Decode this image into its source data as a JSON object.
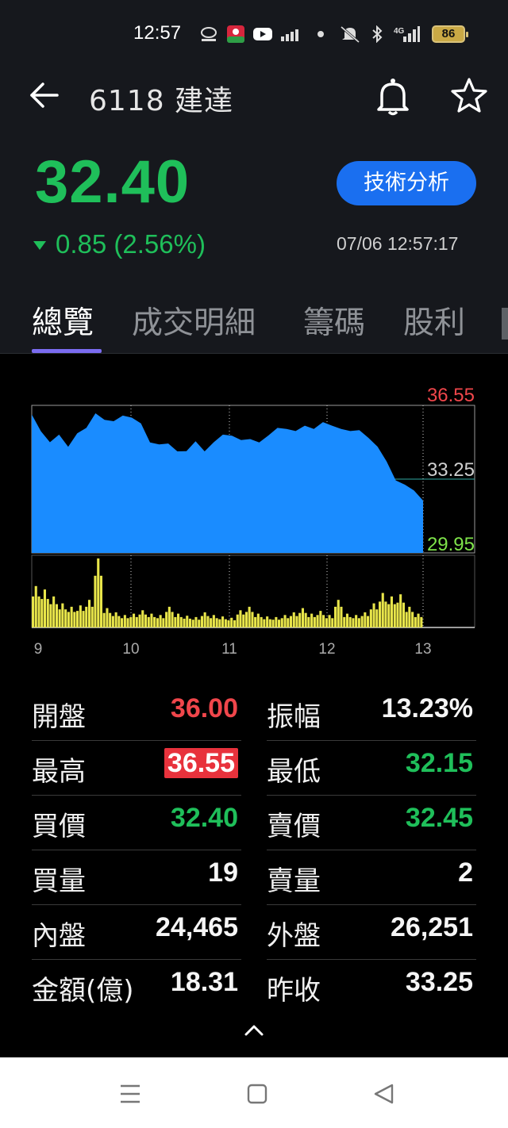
{
  "status_bar": {
    "time": "12:57",
    "icons": [
      "somax-icon",
      "app-icon",
      "youtube-icon",
      "signal-chart-icon",
      "dot-icon",
      "mute-icon",
      "bluetooth-icon",
      "4g-signal-icon"
    ],
    "battery": "86"
  },
  "header": {
    "title": "6118 建達",
    "back_icon": "arrow-left-icon",
    "alert_icon": "bell-icon",
    "favorite_icon": "star-icon"
  },
  "quote": {
    "price": "32.40",
    "change": "0.85 (2.56%)",
    "direction": "down",
    "timestamp": "07/06 12:57:17",
    "tech_button": "技術分析"
  },
  "tabs": [
    {
      "label": "總覽",
      "active": true
    },
    {
      "label": "成交明細",
      "active": false
    },
    {
      "label": "籌碼",
      "active": false
    },
    {
      "label": "股利",
      "active": false
    }
  ],
  "chart_data": {
    "type": "area",
    "y_labels": {
      "high": "36.55",
      "ref": "33.25",
      "low": "29.95"
    },
    "ylim": [
      29.95,
      36.55
    ],
    "x_ticks": [
      "9",
      "10",
      "11",
      "12",
      "13"
    ],
    "price_series": [
      36.0,
      35.5,
      34.9,
      35.1,
      34.8,
      35.3,
      35.4,
      36.3,
      35.9,
      35.7,
      36.2,
      36.0,
      35.6,
      35.0,
      34.8,
      34.7,
      34.6,
      34.5,
      34.8,
      34.6,
      34.9,
      35.1,
      35.3,
      35.0,
      34.9,
      35.0,
      35.2,
      35.4,
      35.6,
      35.4,
      35.5,
      35.6,
      35.8,
      35.5,
      35.6,
      35.4,
      35.3,
      35.2,
      34.7,
      33.9,
      33.3,
      33.0,
      32.6,
      32.4
    ],
    "volume_series": [
      0.6,
      0.55,
      0.45,
      0.35,
      0.3,
      0.32,
      0.4,
      1.0,
      0.28,
      0.22,
      0.18,
      0.2,
      0.25,
      0.2,
      0.18,
      0.3,
      0.2,
      0.17,
      0.15,
      0.22,
      0.18,
      0.16,
      0.14,
      0.25,
      0.3,
      0.2,
      0.16,
      0.15,
      0.18,
      0.22,
      0.28,
      0.2,
      0.24,
      0.18,
      0.4,
      0.2,
      0.18,
      0.22,
      0.35,
      0.5,
      0.45,
      0.48,
      0.3,
      0.2
    ],
    "colors": {
      "price_fill": "#1a8cff",
      "volume": "#e8e54a",
      "high": "#f0464b",
      "low": "#7ee34a",
      "ref": "#d0d0d0"
    }
  },
  "stats": {
    "rows": [
      {
        "l1": "開盤",
        "v1": "36.00",
        "c1": "red",
        "l2": "振幅",
        "v2": "13.23%",
        "c2": "white"
      },
      {
        "l1": "最高",
        "v1": "36.55",
        "c1": "highlight",
        "l2": "最低",
        "v2": "32.15",
        "c2": "green"
      },
      {
        "l1": "買價",
        "v1": "32.40",
        "c1": "green",
        "l2": "賣價",
        "v2": "32.45",
        "c2": "green"
      },
      {
        "l1": "買量",
        "v1": "19",
        "c1": "white",
        "l2": "賣量",
        "v2": "2",
        "c2": "white"
      },
      {
        "l1": "內盤",
        "v1": "24,465",
        "c1": "white",
        "l2": "外盤",
        "v2": "26,251",
        "c2": "white"
      },
      {
        "l1": "金額(億)",
        "v1": "18.31",
        "c1": "white",
        "l2": "昨收",
        "v2": "33.25",
        "c2": "white"
      }
    ]
  },
  "nav": {
    "icons": [
      "recent-apps-icon",
      "home-icon",
      "back-triangle-icon"
    ]
  }
}
